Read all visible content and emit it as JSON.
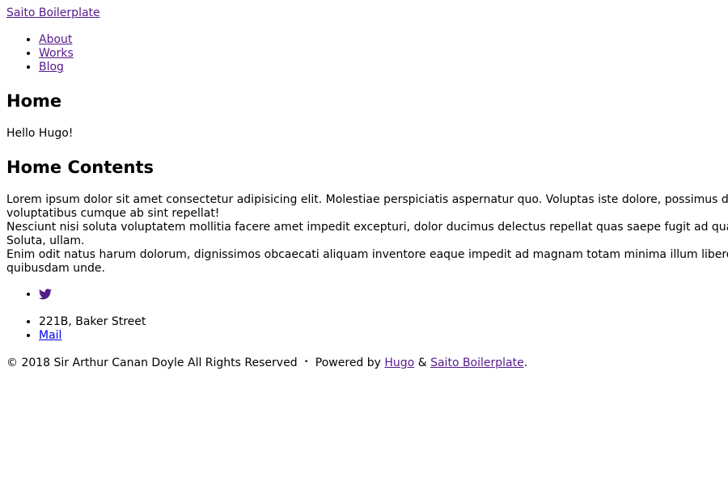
{
  "header": {
    "site_title": "Saito Boilerplate"
  },
  "nav": {
    "items": [
      {
        "label": "About"
      },
      {
        "label": "Works"
      },
      {
        "label": "Blog"
      }
    ]
  },
  "main": {
    "page_heading": "Home",
    "greeting": "Hello Hugo!",
    "contents_heading": "Home Contents",
    "paragraph_lines": [
      "Lorem ipsum dolor sit amet consectetur adipisicing elit. Molestiae perspiciatis aspernatur quo. Voluptas iste dolore, possimus delectus",
      "voluptatibus cumque ab sint repellat!",
      "Nesciunt nisi soluta voluptatem mollitia facere amet impedit excepturi, dolor ducimus delectus repellat quas saepe fugit ad quaerat. C",
      "Soluta, ullam.",
      "Enim odit natus harum dolorum, dignissimos obcaecati aliquam inventore eaque impedit ad magnam totam minima illum libero iure ipsa",
      "quibusdam unde."
    ]
  },
  "footer": {
    "social_icon": "twitter-icon",
    "address": "221B, Baker Street",
    "mail_label": "Mail",
    "copyright": "© 2018 Sir Arthur Canan Doyle All Rights Reserved",
    "separator": "•",
    "powered_by": "Powered by",
    "hugo_label": "Hugo",
    "ampersand": "&",
    "saito_label": "Saito Boilerplate",
    "period": "."
  },
  "colors": {
    "visited_link": "#551a8b",
    "unvisited_link": "#0000ee",
    "text": "#000000",
    "background": "#ffffff"
  }
}
